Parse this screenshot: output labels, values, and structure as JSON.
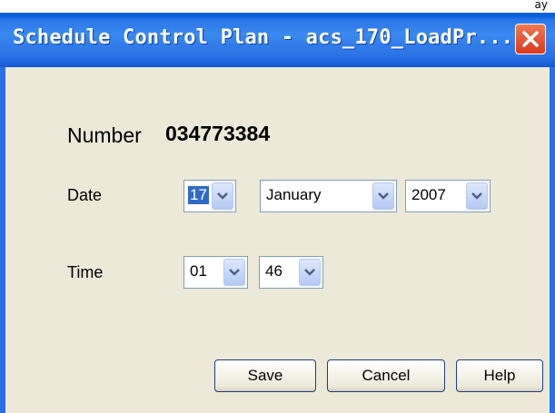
{
  "window": {
    "title": "Schedule Control Plan - acs_170_LoadPr...",
    "top_overflow_text": "ay"
  },
  "form": {
    "number_label": "Number",
    "number_value": "034773384",
    "date_label": "Date",
    "date_day": "17",
    "date_month": "January",
    "date_year": "2007",
    "time_label": "Time",
    "time_hour": "01",
    "time_minute": "46"
  },
  "buttons": {
    "save": "Save",
    "cancel": "Cancel",
    "help": "Help"
  },
  "icons": {
    "close": "close-icon",
    "dropdown": "chevron-down-icon"
  },
  "colors": {
    "titlebar": "#2b78e8",
    "dialog_bg": "#ece9d8",
    "close_button": "#d9381a",
    "selection": "#316ac5"
  }
}
